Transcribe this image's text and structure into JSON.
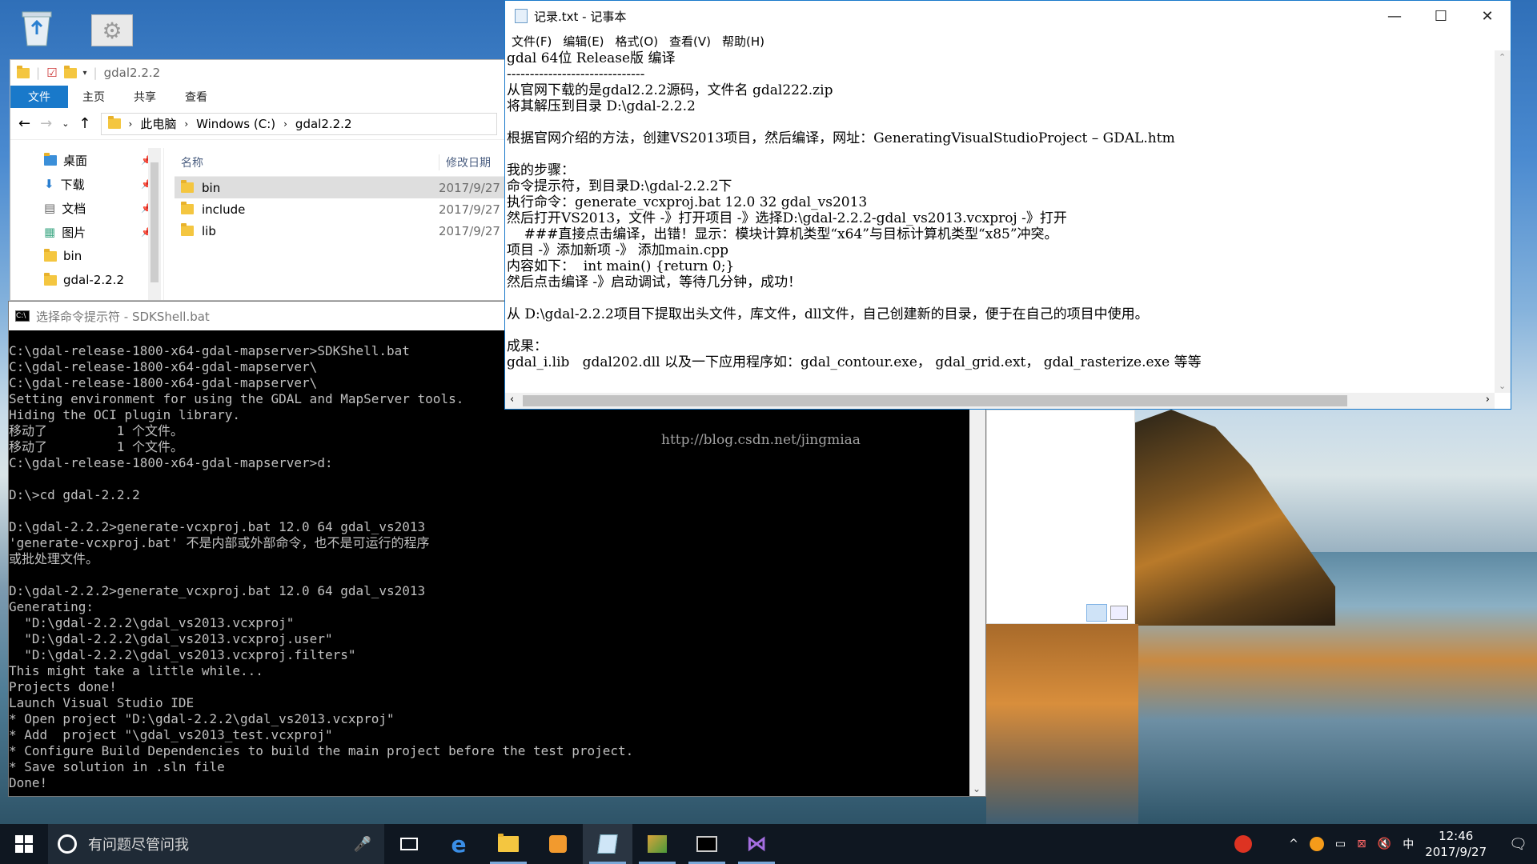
{
  "explorer": {
    "path_title": "gdal2.2.2",
    "ribbon_tabs": [
      "文件",
      "主页",
      "共享",
      "查看"
    ],
    "breadcrumb": [
      "此电脑",
      "Windows (C:)",
      "gdal2.2.2"
    ],
    "nav_items": [
      "桌面",
      "下载",
      "文档",
      "图片",
      "bin",
      "gdal-2.2.2"
    ],
    "col_name": "名称",
    "col_date": "修改日期",
    "files": [
      {
        "name": "bin",
        "date": "2017/9/27"
      },
      {
        "name": "include",
        "date": "2017/9/27"
      },
      {
        "name": "lib",
        "date": "2017/9/27"
      }
    ]
  },
  "cmd": {
    "title": "选择命令提示符 - SDKShell.bat",
    "lines": [
      "C:\\gdal-release-1800-x64-gdal-mapserver>SDKShell.bat",
      "C:\\gdal-release-1800-x64-gdal-mapserver\\",
      "C:\\gdal-release-1800-x64-gdal-mapserver\\",
      "Setting environment for using the GDAL and MapServer tools.",
      "Hiding the OCI plugin library.",
      "移动了         1 个文件。",
      "移动了         1 个文件。",
      "C:\\gdal-release-1800-x64-gdal-mapserver>d:",
      "",
      "D:\\>cd gdal-2.2.2",
      "",
      "D:\\gdal-2.2.2>generate-vcxproj.bat 12.0 64 gdal_vs2013",
      "'generate-vcxproj.bat' 不是内部或外部命令，也不是可运行的程序",
      "或批处理文件。",
      "",
      "D:\\gdal-2.2.2>generate_vcxproj.bat 12.0 64 gdal_vs2013",
      "Generating:",
      "  \"D:\\gdal-2.2.2\\gdal_vs2013.vcxproj\"",
      "  \"D:\\gdal-2.2.2\\gdal_vs2013.vcxproj.user\"",
      "  \"D:\\gdal-2.2.2\\gdal_vs2013.vcxproj.filters\"",
      "This might take a little while...",
      "Projects done!",
      "Launch Visual Studio IDE",
      "* Open project \"D:\\gdal-2.2.2\\gdal_vs2013.vcxproj\"",
      "* Add  project \"\\gdal_vs2013_test.vcxproj\"",
      "* Configure Build Dependencies to build the main project before the test project.",
      "* Save solution in .sln file",
      "Done!"
    ]
  },
  "notepad": {
    "title": "记录.txt - 记事本",
    "menu": [
      "文件(F)",
      "编辑(E)",
      "格式(O)",
      "查看(V)",
      "帮助(H)"
    ],
    "lines": [
      "gdal 64位 Release版 编译",
      "------------------------------",
      "从官网下载的是gdal2.2.2源码，文件名 gdal222.zip",
      "将其解压到目录 D:\\gdal-2.2.2",
      "",
      "根据官网介绍的方法，创建VS2013项目，然后编译，网址：GeneratingVisualStudioProject – GDAL.htm",
      "",
      "我的步骤：",
      "命令提示符，到目录D:\\gdal-2.2.2下",
      "执行命令：generate_vcxproj.bat 12.0 32 gdal_vs2013",
      "然后打开VS2013，文件 -》打开项目 -》选择D:\\gdal-2.2.2-gdal_vs2013.vcxproj -》打开",
      "    ###直接点击编译，出错！显示：模块计算机类型“x64”与目标计算机类型“x85”冲突。",
      "项目 -》添加新项 -》 添加main.cpp",
      "内容如下：  int main() {return 0;}",
      "然后点击编译 -》启动调试，等待几分钟，成功！",
      "",
      "从 D:\\gdal-2.2.2项目下提取出头文件，库文件，dll文件，自己创建新的目录，便于在自己的项目中使用。",
      "",
      "成果：",
      "gdal_i.lib   gdal202.dll 以及一下应用程序如：gdal_contour.exe， gdal_grid.ext， gdal_rasterize.exe 等等"
    ]
  },
  "watermark": "http://blog.csdn.net/jingmiaa",
  "taskbar": {
    "search_placeholder": "有问题尽管问我",
    "apps": [
      "task-view",
      "edge",
      "file-explorer",
      "search-app",
      "notepad",
      "image-app",
      "cmd",
      "visual-studio"
    ],
    "ime": "中",
    "time": "12:46",
    "date": "2017/9/27"
  }
}
